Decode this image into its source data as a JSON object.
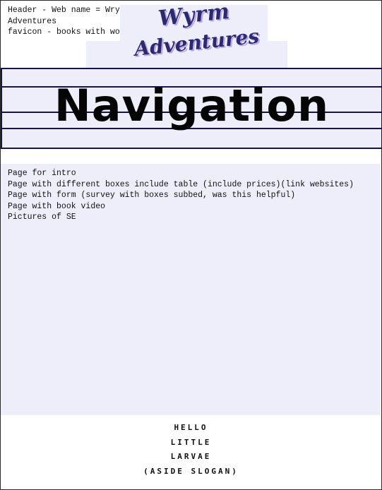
{
  "header": {
    "notes": [
      "Header - Web name = Wrym",
      "Adventures",
      "favicon - books with worm"
    ],
    "logo_line1": "Wyrm",
    "logo_line2": "Adventures"
  },
  "nav": {
    "title": "Navigation"
  },
  "main": {
    "items": [
      "Page for intro",
      "Page with different boxes include table (include prices)(link websites)",
      "Page with form (survey with boxes subbed, was this helpful)",
      "Page with book video",
      "Pictures of SE"
    ]
  },
  "footer": {
    "slogan_lines": [
      "HELLO",
      "LITTLE",
      "LARVAE",
      "(ASIDE SLOGAN)"
    ]
  },
  "colors": {
    "panel_bg": "#eeeefb",
    "nav_border": "#14144a",
    "logo_text": "#2c2a6e",
    "logo_shadow": "#b9a7e6"
  }
}
